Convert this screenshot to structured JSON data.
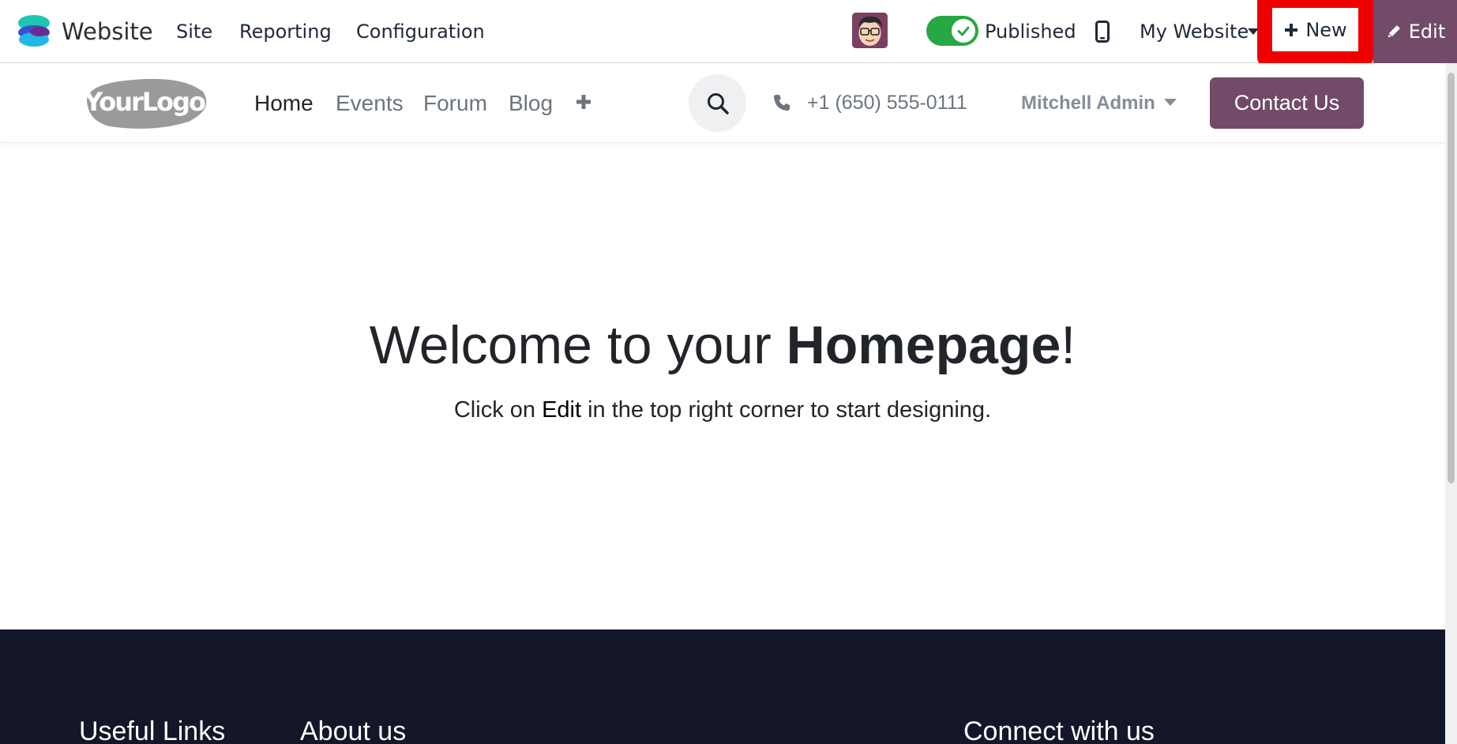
{
  "topbar": {
    "app_name": "Website",
    "menus": [
      "Site",
      "Reporting",
      "Configuration"
    ],
    "published_label": "Published",
    "website_selector": "My Website",
    "new_label": "New",
    "edit_label": "Edit"
  },
  "site_header": {
    "logo_text": "YourLogo",
    "nav": [
      "Home",
      "Events",
      "Forum",
      "Blog"
    ],
    "phone": "+1 (650) 555-0111",
    "user_name": "Mitchell Admin",
    "contact_label": "Contact Us"
  },
  "hero": {
    "title_prefix": "Welcome to your ",
    "title_bold": "Homepage",
    "title_suffix": "!",
    "sub_prefix": "Click on ",
    "sub_bold": "Edit",
    "sub_suffix": " in the top right corner to start designing."
  },
  "footer": {
    "headings": [
      "Useful Links",
      "About us",
      "Connect with us"
    ]
  },
  "colors": {
    "brand_purple": "#714b67",
    "highlight_red": "#ee0000",
    "toggle_green": "#28a745",
    "footer_bg": "#141629"
  },
  "state": {
    "published": true,
    "active_nav": "Home"
  }
}
